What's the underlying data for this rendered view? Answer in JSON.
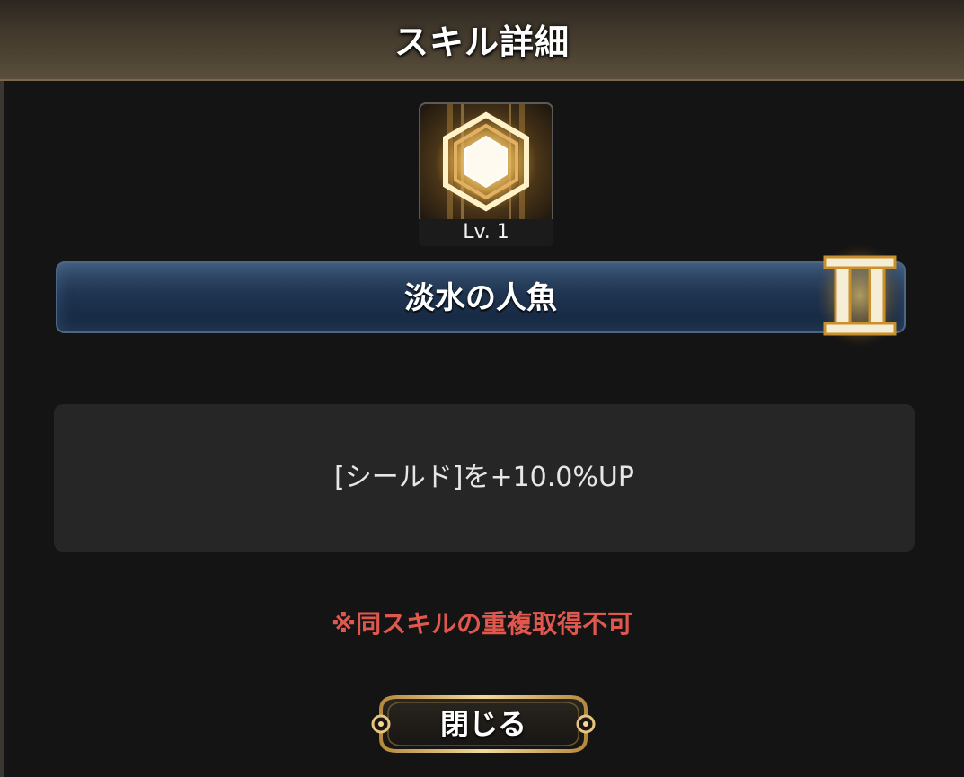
{
  "dialog": {
    "title": "スキル詳細",
    "colors": {
      "header": "#5a4e3a",
      "panel": "#141414",
      "gold": "#e8c47a",
      "name_bar": "#1f3450",
      "warning": "#e0574e"
    }
  },
  "skill": {
    "icon": "hexagon-gem-icon",
    "level_label": "Lv. 1",
    "name": "淡水の人魚",
    "rank_icon": "roman-numeral-two-badge-icon",
    "description": "[シールド]を+10.0%UP"
  },
  "notice": {
    "text": "※同スキルの重複取得不可"
  },
  "actions": {
    "close_label": "閉じる"
  }
}
